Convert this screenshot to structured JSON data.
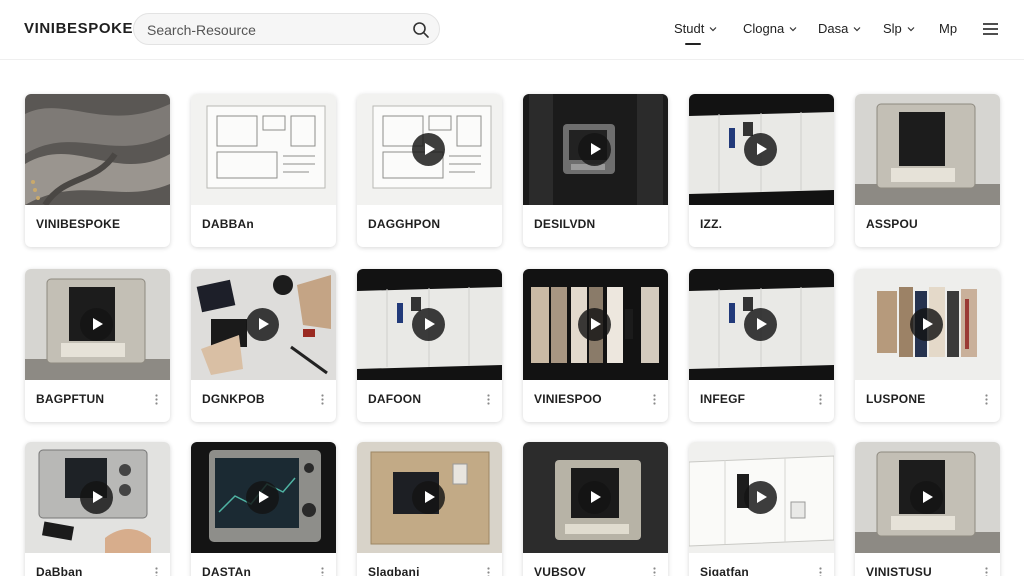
{
  "header": {
    "logo": "VINIBESPOKE",
    "search": {
      "placeholder": "Search-Resource"
    },
    "nav": [
      {
        "label": "Studt",
        "active": true
      },
      {
        "label": "Clogna"
      },
      {
        "label": "Dasa"
      },
      {
        "label": "Slp"
      },
      {
        "label": "Mp"
      }
    ]
  },
  "grid": {
    "cards": [
      {
        "label": "VINIBESPOKE",
        "thumb": "fabric-folds",
        "video": false,
        "menu": false
      },
      {
        "label": "DABBAn",
        "thumb": "blueprint",
        "video": false,
        "menu": false
      },
      {
        "label": "DAGGHPON",
        "thumb": "blueprint",
        "video": true,
        "menu": false
      },
      {
        "label": "DESILVDN",
        "thumb": "device-dark",
        "video": true,
        "menu": false
      },
      {
        "label": "IZZ.",
        "thumb": "scroll-dark",
        "video": true,
        "menu": false
      },
      {
        "label": "ASSPOU",
        "thumb": "machine",
        "video": false,
        "menu": false
      },
      {
        "label": "BAGPFTUN",
        "thumb": "machine",
        "video": true,
        "menu": true
      },
      {
        "label": "DGNKPOB",
        "thumb": "tools-flatlay",
        "video": true,
        "menu": true
      },
      {
        "label": "DAFOON",
        "thumb": "scroll-dark",
        "video": true,
        "menu": true
      },
      {
        "label": "VINIESPOO",
        "thumb": "fabric-rolls",
        "video": true,
        "menu": true
      },
      {
        "label": "INFEGF",
        "thumb": "scroll-dark",
        "video": true,
        "menu": true
      },
      {
        "label": "LUSPONE",
        "thumb": "textile-hanging",
        "video": true,
        "menu": true
      },
      {
        "label": "DaBban",
        "thumb": "device-light",
        "video": true,
        "menu": true
      },
      {
        "label": "DASTAn",
        "thumb": "device-screen",
        "video": true,
        "menu": true
      },
      {
        "label": "Slagbani",
        "thumb": "burlap",
        "video": true,
        "menu": true
      },
      {
        "label": "VUBSOV",
        "thumb": "machine-dark",
        "video": true,
        "menu": true
      },
      {
        "label": "Sigatfan",
        "thumb": "scroll-light",
        "video": true,
        "menu": true
      },
      {
        "label": "VINISTUSU",
        "thumb": "machine",
        "video": true,
        "menu": true
      }
    ]
  }
}
